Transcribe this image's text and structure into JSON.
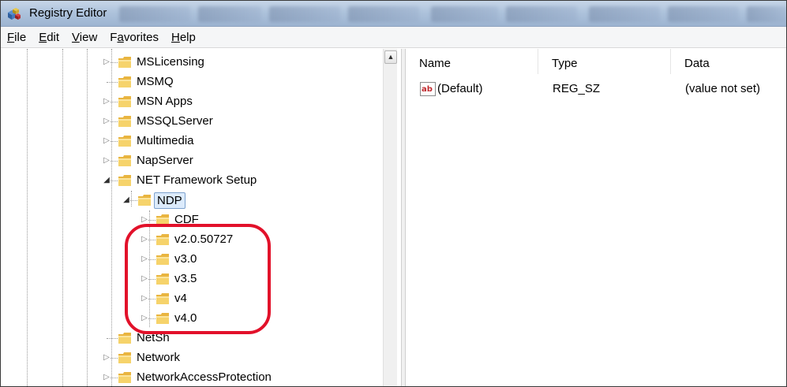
{
  "window": {
    "title": "Registry Editor",
    "icon": "registry-cubes-icon"
  },
  "menu": {
    "items": [
      {
        "label": "File",
        "underline": "F",
        "rest": "ile"
      },
      {
        "label": "Edit",
        "underline": "E",
        "rest": "dit"
      },
      {
        "label": "View",
        "underline": "V",
        "rest": "iew"
      },
      {
        "label": "Favorites",
        "underline": "a",
        "pre": "F",
        "rest": "vorites"
      },
      {
        "label": "Help",
        "underline": "H",
        "rest": "elp"
      }
    ]
  },
  "tree": {
    "nodes": [
      {
        "label": "MSLicensing",
        "expander": "▷"
      },
      {
        "label": "MSMQ",
        "expander": ""
      },
      {
        "label": "MSN Apps",
        "expander": "▷"
      },
      {
        "label": "MSSQLServer",
        "expander": "▷"
      },
      {
        "label": "Multimedia",
        "expander": "▷"
      },
      {
        "label": "NapServer",
        "expander": "▷"
      },
      {
        "label": "NET Framework Setup",
        "expander": "◢"
      },
      {
        "label": "NDP",
        "expander": "◢",
        "selected": true
      },
      {
        "label": "CDF",
        "expander": "▷"
      },
      {
        "label": "v2.0.50727",
        "expander": "▷"
      },
      {
        "label": "v3.0",
        "expander": "▷"
      },
      {
        "label": "v3.5",
        "expander": "▷"
      },
      {
        "label": "v4",
        "expander": "▷"
      },
      {
        "label": "v4.0",
        "expander": "▷"
      },
      {
        "label": "NetSh",
        "expander": ""
      },
      {
        "label": "Network",
        "expander": "▷"
      },
      {
        "label": "NetworkAccessProtection",
        "expander": "▷"
      }
    ]
  },
  "values": {
    "columns": [
      "Name",
      "Type",
      "Data"
    ],
    "rows": [
      {
        "name": "(Default)",
        "type": "REG_SZ",
        "data": "(value not set)",
        "icon": "string-value-ab-icon"
      }
    ]
  },
  "colors": {
    "highlight_ring": "#e2112a",
    "selection_bg": "#dcebfc",
    "title_bar": "#aec3dc"
  }
}
